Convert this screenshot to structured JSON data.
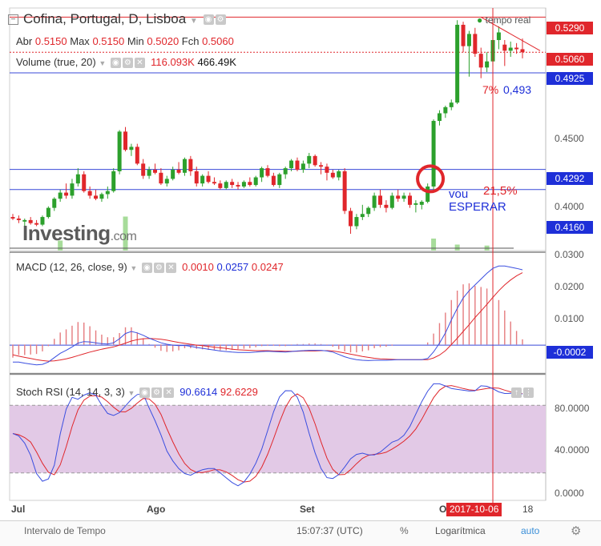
{
  "header": {
    "symbol": "Cofina, Portugal, D, Lisboa",
    "tempo_real": "tempo real",
    "abr_label": "Abr",
    "abr": "0.5150",
    "max_label": "Max",
    "max": "0.5150",
    "min_label": "Min",
    "min": "0.5020",
    "fch_label": "Fch",
    "fch": "0.5060",
    "volume_label": "Volume (true, 20)",
    "volume_v1": "116.093K",
    "volume_v2": "466.49K"
  },
  "price_axis": {
    "ticks": [
      "0.4500",
      "0.4000"
    ],
    "tags": [
      {
        "text": "0.5290",
        "color": "#e0262b"
      },
      {
        "text": "0.5060",
        "color": "#e0262b"
      },
      {
        "text": "0.4925",
        "color": "#1e2fd8"
      },
      {
        "text": "0.4292",
        "color": "#1e2fd8"
      },
      {
        "text": "0.4160",
        "color": "#1e2fd8"
      }
    ],
    "extra_tick": "0.0300"
  },
  "annotations": {
    "pct7": "7%",
    "val493": "0,493",
    "pct21": "21,5%",
    "vou": "vou",
    "esperar": "ESPERAR"
  },
  "watermark": {
    "main": "Investing",
    "suffix": ".com"
  },
  "macd": {
    "label": "MACD (12, 26, close, 9)",
    "v1": "0.0010",
    "v2": "0.0257",
    "v3": "0.0247",
    "ticks": [
      "0.0200",
      "0.0100"
    ],
    "tag": "-0.0002"
  },
  "stoch": {
    "label": "Stoch RSI (14, 14, 3, 3)",
    "v1": "90.6614",
    "v2": "92.6229",
    "ticks": [
      "80.0000",
      "40.0000",
      "0.0000"
    ]
  },
  "xaxis": {
    "labels": [
      "Jul",
      "Ago",
      "Set",
      "O",
      "18"
    ],
    "date_tag": "2017-10-06"
  },
  "footer": {
    "intervalo": "Intervalo de Tempo",
    "time": "15:07:37 (UTC)",
    "pct": "%",
    "log": "Logarítmica",
    "auto": "auto"
  },
  "colors": {
    "up": "#2ca02c",
    "down": "#e0262b",
    "macd": "#3a4ee0",
    "signal": "#e0262b",
    "band": "#e2c9e6"
  },
  "chart_data": {
    "type": "candlestick",
    "y_range": [
      0.376,
      0.535
    ],
    "candles": [
      [
        0.398,
        0.4,
        0.396,
        0.397
      ],
      [
        0.397,
        0.399,
        0.394,
        0.396
      ],
      [
        0.395,
        0.397,
        0.392,
        0.396
      ],
      [
        0.396,
        0.398,
        0.393,
        0.394
      ],
      [
        0.394,
        0.396,
        0.392,
        0.393
      ],
      [
        0.393,
        0.399,
        0.392,
        0.398
      ],
      [
        0.398,
        0.405,
        0.397,
        0.404
      ],
      [
        0.404,
        0.411,
        0.402,
        0.41
      ],
      [
        0.41,
        0.416,
        0.408,
        0.414
      ],
      [
        0.414,
        0.42,
        0.41,
        0.412
      ],
      [
        0.412,
        0.423,
        0.41,
        0.42
      ],
      [
        0.42,
        0.43,
        0.418,
        0.426
      ],
      [
        0.426,
        0.428,
        0.414,
        0.415
      ],
      [
        0.415,
        0.418,
        0.41,
        0.412
      ],
      [
        0.412,
        0.416,
        0.409,
        0.41
      ],
      [
        0.41,
        0.414,
        0.408,
        0.413
      ],
      [
        0.413,
        0.418,
        0.41,
        0.415
      ],
      [
        0.415,
        0.43,
        0.414,
        0.428
      ],
      [
        0.428,
        0.455,
        0.426,
        0.454
      ],
      [
        0.454,
        0.457,
        0.441,
        0.442
      ],
      [
        0.442,
        0.446,
        0.438,
        0.444
      ],
      [
        0.444,
        0.446,
        0.432,
        0.433
      ],
      [
        0.433,
        0.436,
        0.423,
        0.425
      ],
      [
        0.425,
        0.431,
        0.423,
        0.429
      ],
      [
        0.429,
        0.433,
        0.426,
        0.427
      ],
      [
        0.427,
        0.43,
        0.419,
        0.42
      ],
      [
        0.42,
        0.425,
        0.418,
        0.423
      ],
      [
        0.423,
        0.431,
        0.422,
        0.429
      ],
      [
        0.429,
        0.434,
        0.426,
        0.427
      ],
      [
        0.427,
        0.437,
        0.425,
        0.436
      ],
      [
        0.436,
        0.438,
        0.425,
        0.428
      ],
      [
        0.428,
        0.431,
        0.418,
        0.42
      ],
      [
        0.42,
        0.426,
        0.418,
        0.425
      ],
      [
        0.425,
        0.428,
        0.42,
        0.421
      ],
      [
        0.421,
        0.424,
        0.419,
        0.42
      ],
      [
        0.42,
        0.422,
        0.416,
        0.417
      ],
      [
        0.417,
        0.422,
        0.416,
        0.421
      ],
      [
        0.421,
        0.423,
        0.417,
        0.419
      ],
      [
        0.419,
        0.421,
        0.416,
        0.418
      ],
      [
        0.418,
        0.422,
        0.417,
        0.421
      ],
      [
        0.421,
        0.424,
        0.418,
        0.419
      ],
      [
        0.419,
        0.425,
        0.418,
        0.424
      ],
      [
        0.424,
        0.431,
        0.421,
        0.43
      ],
      [
        0.43,
        0.432,
        0.424,
        0.425
      ],
      [
        0.425,
        0.427,
        0.418,
        0.419
      ],
      [
        0.419,
        0.427,
        0.417,
        0.426
      ],
      [
        0.426,
        0.431,
        0.423,
        0.43
      ],
      [
        0.43,
        0.436,
        0.428,
        0.435
      ],
      [
        0.435,
        0.437,
        0.428,
        0.429
      ],
      [
        0.429,
        0.435,
        0.427,
        0.433
      ],
      [
        0.433,
        0.44,
        0.43,
        0.438
      ],
      [
        0.438,
        0.439,
        0.431,
        0.432
      ],
      [
        0.432,
        0.434,
        0.426,
        0.431
      ],
      [
        0.431,
        0.433,
        0.422,
        0.427
      ],
      [
        0.427,
        0.429,
        0.423,
        0.424
      ],
      [
        0.424,
        0.429,
        0.422,
        0.428
      ],
      [
        0.428,
        0.43,
        0.4,
        0.402
      ],
      [
        0.402,
        0.404,
        0.387,
        0.392
      ],
      [
        0.392,
        0.4,
        0.39,
        0.398
      ],
      [
        0.398,
        0.406,
        0.396,
        0.4
      ],
      [
        0.4,
        0.405,
        0.398,
        0.404
      ],
      [
        0.404,
        0.414,
        0.402,
        0.412
      ],
      [
        0.412,
        0.416,
        0.404,
        0.406
      ],
      [
        0.406,
        0.409,
        0.401,
        0.404
      ],
      [
        0.404,
        0.414,
        0.403,
        0.412
      ],
      [
        0.412,
        0.416,
        0.408,
        0.41
      ],
      [
        0.41,
        0.414,
        0.408,
        0.412
      ],
      [
        0.412,
        0.414,
        0.404,
        0.406
      ],
      [
        0.406,
        0.409,
        0.401,
        0.407
      ],
      [
        0.406,
        0.409,
        0.403,
        0.408
      ],
      [
        0.408,
        0.42,
        0.407,
        0.418
      ],
      [
        0.418,
        0.462,
        0.416,
        0.461
      ],
      [
        0.461,
        0.468,
        0.458,
        0.466
      ],
      [
        0.466,
        0.471,
        0.463,
        0.47
      ],
      [
        0.47,
        0.475,
        0.468,
        0.473
      ],
      [
        0.473,
        0.527,
        0.472,
        0.524
      ],
      [
        0.524,
        0.526,
        0.506,
        0.51
      ],
      [
        0.51,
        0.52,
        0.49,
        0.518
      ],
      [
        0.518,
        0.522,
        0.503,
        0.505
      ],
      [
        0.505,
        0.509,
        0.489,
        0.496
      ],
      [
        0.496,
        0.506,
        0.493,
        0.5
      ],
      [
        0.5,
        0.517,
        0.497,
        0.514
      ],
      [
        0.514,
        0.523,
        0.508,
        0.519
      ],
      [
        0.511,
        0.514,
        0.497,
        0.507
      ],
      [
        0.507,
        0.513,
        0.503,
        0.509
      ],
      [
        0.509,
        0.512,
        0.505,
        0.508
      ],
      [
        0.508,
        0.515,
        0.502,
        0.506
      ]
    ],
    "volume": [
      4,
      4,
      4,
      4,
      4,
      4,
      4,
      4,
      50,
      4,
      4,
      4,
      4,
      4,
      4,
      4,
      4,
      4,
      4,
      170,
      4,
      4,
      4,
      4,
      4,
      4,
      4,
      4,
      4,
      4,
      4,
      4,
      4,
      4,
      4,
      4,
      4,
      4,
      4,
      4,
      4,
      4,
      4,
      4,
      4,
      4,
      4,
      4,
      4,
      4,
      4,
      4,
      4,
      4,
      4,
      4,
      4,
      4,
      4,
      4,
      4,
      4,
      4,
      4,
      4,
      4,
      4,
      4,
      4,
      4,
      4,
      60,
      4,
      4,
      4,
      30,
      4,
      4,
      4,
      4,
      25,
      4,
      4,
      4,
      4,
      4,
      4
    ],
    "hlines_blue": [
      0.4925,
      0.4292,
      0.416
    ],
    "hlines_red": [
      0.529
    ],
    "macd_line": [
      -0.006,
      -0.006,
      -0.0064,
      -0.0067,
      -0.007,
      -0.0068,
      -0.006,
      -0.0045,
      -0.003,
      -0.002,
      -0.0008,
      0.0005,
      0.001,
      0.0009,
      0.0006,
      0.0003,
      0.0002,
      0.0006,
      0.002,
      0.0038,
      0.0045,
      0.004,
      0.0032,
      0.0022,
      0.0014,
      0.0006,
      0.0001,
      -0.0002,
      -0.0004,
      -0.0003,
      -0.0006,
      -0.001,
      -0.0013,
      -0.0016,
      -0.0019,
      -0.0022,
      -0.0024,
      -0.0026,
      -0.0027,
      -0.0027,
      -0.0027,
      -0.0026,
      -0.0024,
      -0.0023,
      -0.0024,
      -0.0025,
      -0.0026,
      -0.0024,
      -0.0022,
      -0.0021,
      -0.002,
      -0.002,
      -0.002,
      -0.0022,
      -0.0026,
      -0.0034,
      -0.0042,
      -0.0048,
      -0.0052,
      -0.0054,
      -0.0055,
      -0.0054,
      -0.0054,
      -0.0054,
      -0.0053,
      -0.0052,
      -0.0052,
      -0.0052,
      -0.0052,
      -0.0052,
      -0.0048,
      -0.0025,
      0.0005,
      0.004,
      0.0085,
      0.0125,
      0.016,
      0.0185,
      0.0205,
      0.0225,
      0.0245,
      0.0262,
      0.027,
      0.027,
      0.0266,
      0.0262,
      0.0257
    ],
    "signal_line": [
      -0.0035,
      -0.004,
      -0.0044,
      -0.0048,
      -0.0052,
      -0.0055,
      -0.0057,
      -0.0056,
      -0.0053,
      -0.0049,
      -0.0044,
      -0.0038,
      -0.0032,
      -0.0026,
      -0.0021,
      -0.0016,
      -0.0012,
      -0.0008,
      -0.0002,
      0.0005,
      0.0012,
      0.0017,
      0.002,
      0.0021,
      0.002,
      0.0018,
      0.0015,
      0.0011,
      0.0007,
      0.0004,
      0.0001,
      -0.0002,
      -0.0004,
      -0.0006,
      -0.0009,
      -0.0011,
      -0.0013,
      -0.0016,
      -0.0018,
      -0.0019,
      -0.002,
      -0.0021,
      -0.0021,
      -0.0021,
      -0.0022,
      -0.0022,
      -0.0023,
      -0.0023,
      -0.0023,
      -0.0022,
      -0.0022,
      -0.0022,
      -0.0021,
      -0.0021,
      -0.0022,
      -0.0025,
      -0.0029,
      -0.0033,
      -0.0037,
      -0.0041,
      -0.0044,
      -0.0047,
      -0.0049,
      -0.005,
      -0.0051,
      -0.0052,
      -0.0052,
      -0.0052,
      -0.0052,
      -0.0052,
      -0.0052,
      -0.0046,
      -0.0036,
      -0.0021,
      0.0,
      0.0022,
      0.0045,
      0.0068,
      0.0093,
      0.0115,
      0.0138,
      0.0162,
      0.0185,
      0.0205,
      0.0222,
      0.0236,
      0.0247
    ]
  }
}
